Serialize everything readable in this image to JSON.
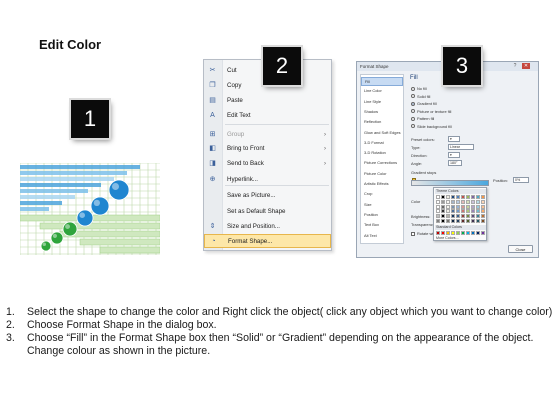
{
  "title": "Edit Color",
  "badges": [
    "1",
    "2",
    "3"
  ],
  "panel1": {
    "bar_colors": [
      "#4ea4dc",
      "#7dc0ea",
      "#a9d6f1"
    ],
    "ball_colors": [
      "#2fa43c",
      "#2fa43c",
      "#2fa43c",
      "#1f86d0",
      "#1f86d0",
      "#1f86d0"
    ]
  },
  "menu": {
    "items": [
      {
        "label": "Cut",
        "icon": "scissors-icon",
        "glyph": "✂",
        "enabled": true,
        "submenu": false
      },
      {
        "label": "Copy",
        "icon": "copy-icon",
        "glyph": "❐",
        "enabled": true,
        "submenu": false
      },
      {
        "label": "Paste",
        "icon": "paste-icon",
        "glyph": "▤",
        "enabled": true,
        "submenu": false
      },
      {
        "label": "Edit Text",
        "icon": "edit-text-icon",
        "glyph": "A",
        "enabled": true,
        "submenu": false
      },
      {
        "label": "Group",
        "icon": "group-icon",
        "glyph": "⊞",
        "enabled": false,
        "submenu": true
      },
      {
        "label": "Bring to Front",
        "icon": "bring-front-icon",
        "glyph": "◧",
        "enabled": true,
        "submenu": true
      },
      {
        "label": "Send to Back",
        "icon": "send-back-icon",
        "glyph": "◨",
        "enabled": true,
        "submenu": true
      },
      {
        "label": "Hyperlink...",
        "icon": "hyperlink-icon",
        "glyph": "⊕",
        "enabled": true,
        "submenu": false
      },
      {
        "label": "Save as Picture...",
        "icon": "",
        "glyph": "",
        "enabled": true,
        "submenu": false
      },
      {
        "label": "Set as Default Shape",
        "icon": "",
        "glyph": "",
        "enabled": true,
        "submenu": false
      },
      {
        "label": "Size and Position...",
        "icon": "size-position-icon",
        "glyph": "⇕",
        "enabled": true,
        "submenu": false
      },
      {
        "label": "Format Shape...",
        "icon": "format-shape-icon",
        "glyph": "◔",
        "enabled": true,
        "submenu": false,
        "highlighted": true
      }
    ]
  },
  "dialog": {
    "title": "Format Shape",
    "nav": [
      "Fill",
      "Line Color",
      "Line Style",
      "Shadow",
      "Reflection",
      "Glow and Soft Edges",
      "3-D Format",
      "3-D Rotation",
      "Picture Corrections",
      "Picture Color",
      "Artistic Effects",
      "Crop",
      "Size",
      "Position",
      "Text Box",
      "Alt Text"
    ],
    "section": "Fill",
    "fill_options": [
      "No fill",
      "Solid fill",
      "Gradient fill",
      "Picture or texture fill",
      "Pattern fill",
      "Slide background fill"
    ],
    "selected_fill": 2,
    "preset_label": "Preset colors:",
    "type_label": "Type:",
    "type_value": "Linear",
    "direction_label": "Direction:",
    "angle_label": "Angle:",
    "angle_value": "180°",
    "stops_label": "Gradient stops",
    "color_label": "Color",
    "position_label": "Position:",
    "position_value": "0%",
    "brightness_label": "Brightness:",
    "transparency_label": "Transparency:",
    "rotate_label": "Rotate with shape",
    "theme_colors_label": "Theme Colors",
    "standard_colors_label": "Standard Colors",
    "more_colors_label": "More Colors...",
    "close_label": "Close",
    "theme_colors": [
      "#ffffff",
      "#000000",
      "#eeece1",
      "#1f497d",
      "#4f81bd",
      "#c0504d",
      "#9bbb59",
      "#8064a2",
      "#4bacc6",
      "#f79646"
    ],
    "standard_colors": [
      "#c00000",
      "#ff0000",
      "#ffc000",
      "#ffff00",
      "#92d050",
      "#00b050",
      "#00b0f0",
      "#0070c0",
      "#002060",
      "#7030a0"
    ]
  },
  "steps": [
    {
      "n": "1.",
      "text": "Select the shape to change the color and Right click the object( click any object which you want to change color)"
    },
    {
      "n": "2.",
      "text": "Choose Format Shape in the dialog box."
    },
    {
      "n": "3.",
      "text": "Choose “Fill” in the Format Shape box then “Solid” or “Gradient” depending on the appearance of the object. Change colour as shown in the picture."
    }
  ]
}
